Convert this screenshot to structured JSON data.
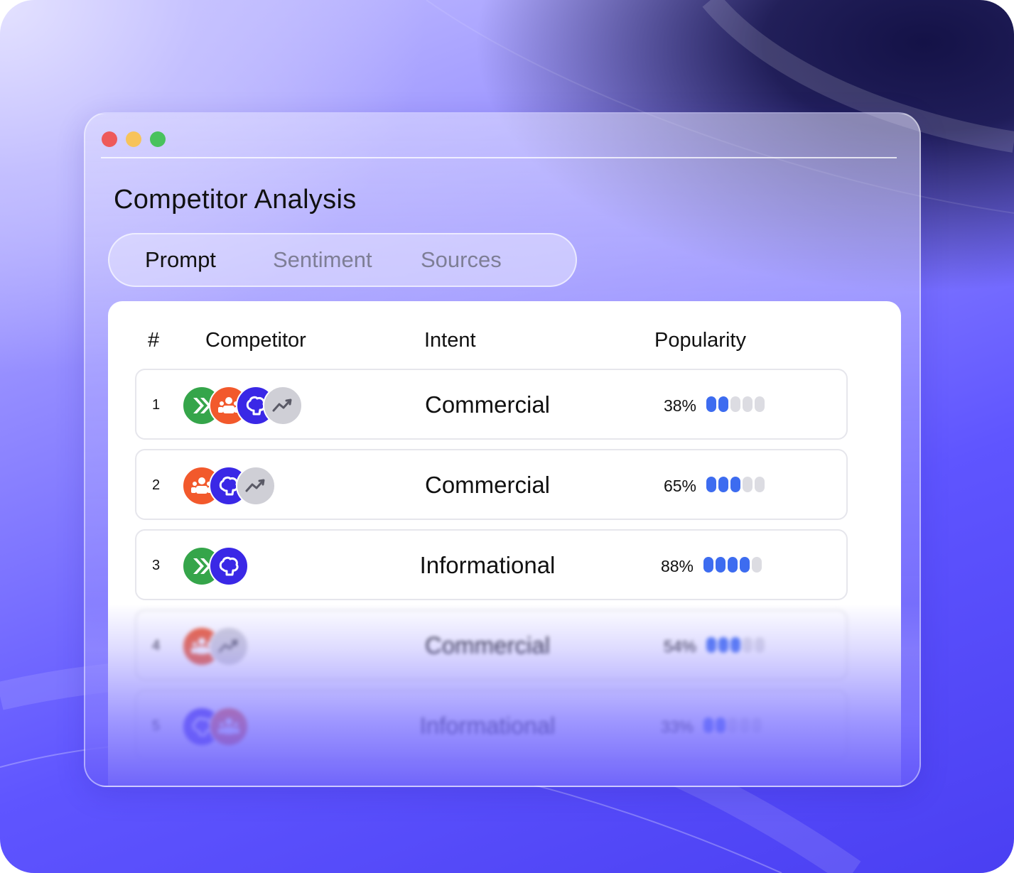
{
  "window": {
    "controls": [
      "close",
      "minimize",
      "zoom"
    ],
    "title": "Competitor Analysis"
  },
  "tabs": [
    {
      "label": "Prompt",
      "active": true
    },
    {
      "label": "Sentiment",
      "active": false
    },
    {
      "label": "Sources",
      "active": false
    }
  ],
  "table": {
    "headers": {
      "rank": "#",
      "competitor": "Competitor",
      "intent": "Intent",
      "popularity": "Popularity"
    },
    "rows": [
      {
        "rank": "1",
        "competitors": [
          "chevron-icon",
          "people-icon",
          "brain-icon",
          "trend-icon"
        ],
        "intent": "Commercial",
        "popularity": "38%",
        "level": 2
      },
      {
        "rank": "2",
        "competitors": [
          "people-icon",
          "brain-icon",
          "trend-icon"
        ],
        "intent": "Commercial",
        "popularity": "65%",
        "level": 3
      },
      {
        "rank": "3",
        "competitors": [
          "chevron-icon",
          "brain-icon"
        ],
        "intent": "Informational",
        "popularity": "88%",
        "level": 4
      },
      {
        "rank": "4",
        "competitors": [
          "people-icon",
          "trend-icon"
        ],
        "intent": "Commercial",
        "popularity": "54%",
        "level": 3
      },
      {
        "rank": "5",
        "competitors": [
          "brain-icon",
          "people-icon"
        ],
        "intent": "Informational",
        "popularity": "33%",
        "level": 2
      }
    ],
    "popularity_scale_max": 5
  },
  "colors": {
    "accent_bar": "#3d6cf0",
    "chevron_brand": "#35a54a",
    "people_brand": "#f2592c",
    "brain_brand": "#3a28e6",
    "trend_brand": "#cfcfd6"
  }
}
